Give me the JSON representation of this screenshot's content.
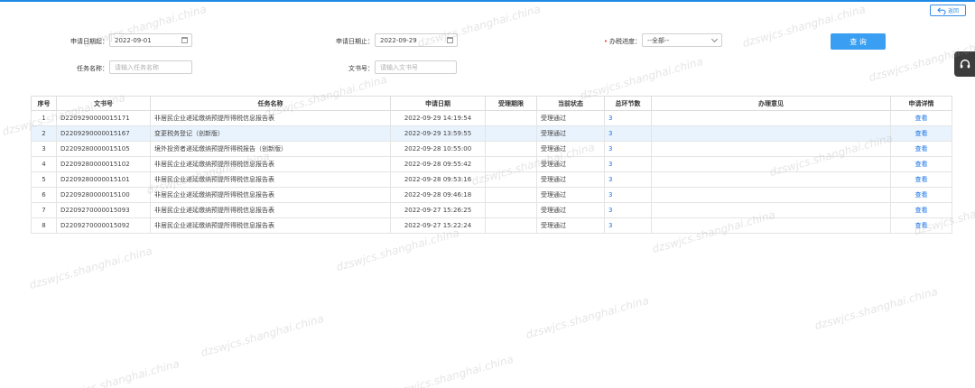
{
  "toolbar": {
    "back_label": "返回"
  },
  "search": {
    "start_date_label": "申请日期起：",
    "start_date_value": "2022-09-01",
    "end_date_label": "申请日期止：",
    "end_date_value": "2022-09-29",
    "status_label": "办税进度：",
    "status_value": "--全部--",
    "task_name_label": "任务名称：",
    "task_name_placeholder": "请输入任务名称",
    "doc_no_label": "文书号：",
    "doc_no_placeholder": "请输入文书号",
    "query_label": "查 询"
  },
  "table": {
    "headers": [
      "序号",
      "文书号",
      "任务名称",
      "申请日期",
      "受理期限",
      "当前状态",
      "总环节数",
      "办理意见",
      "申请详情"
    ],
    "rows": [
      {
        "no": "1",
        "doc": "D2209290000015171",
        "task": "非居民企业递延缴纳预提所得税信息报告表",
        "date": "2022-09-29 14:19:54",
        "deadline": "",
        "status": "受理通过",
        "steps": "3",
        "opinion": "",
        "detail": "查看"
      },
      {
        "no": "2",
        "doc": "D2209290000015167",
        "task": "变更税务登记（创新版）",
        "date": "2022-09-29 13:59:55",
        "deadline": "",
        "status": "受理通过",
        "steps": "3",
        "opinion": "",
        "detail": "查看"
      },
      {
        "no": "3",
        "doc": "D2209280000015105",
        "task": "境外投资者递延缴纳预提所得税报告（创新版）",
        "date": "2022-09-28 10:55:00",
        "deadline": "",
        "status": "受理通过",
        "steps": "3",
        "opinion": "",
        "detail": "查看"
      },
      {
        "no": "4",
        "doc": "D2209280000015102",
        "task": "非居民企业递延缴纳预提所得税信息报告表",
        "date": "2022-09-28 09:55:42",
        "deadline": "",
        "status": "受理通过",
        "steps": "3",
        "opinion": "",
        "detail": "查看"
      },
      {
        "no": "5",
        "doc": "D2209280000015101",
        "task": "非居民企业递延缴纳预提所得税信息报告表",
        "date": "2022-09-28 09:53:16",
        "deadline": "",
        "status": "受理通过",
        "steps": "3",
        "opinion": "",
        "detail": "查看"
      },
      {
        "no": "6",
        "doc": "D2209280000015100",
        "task": "非居民企业递延缴纳预提所得税信息报告表",
        "date": "2022-09-28 09:46:18",
        "deadline": "",
        "status": "受理通过",
        "steps": "3",
        "opinion": "",
        "detail": "查看"
      },
      {
        "no": "7",
        "doc": "D2209270000015093",
        "task": "非居民企业递延缴纳预提所得税信息报告表",
        "date": "2022-09-27 15:26:25",
        "deadline": "",
        "status": "受理通过",
        "steps": "3",
        "opinion": "",
        "detail": "查看"
      },
      {
        "no": "8",
        "doc": "D2209270000015092",
        "task": "非居民企业递延缴纳预提所得税信息报告表",
        "date": "2022-09-27 15:22:24",
        "deadline": "",
        "status": "受理通过",
        "steps": "3",
        "opinion": "",
        "detail": "查看"
      }
    ]
  },
  "watermark": {
    "text": "dzswjcs.shanghai.china"
  },
  "colors": {
    "accent": "#3a9ff2",
    "link": "#1a73e8",
    "highlight_row": "#e9f3fd",
    "required": "#e53935"
  },
  "icons": {
    "back": "back-arrow-icon",
    "calendar": "calendar-icon",
    "dropdown": "chevron-down-icon",
    "support": "headset-icon"
  }
}
